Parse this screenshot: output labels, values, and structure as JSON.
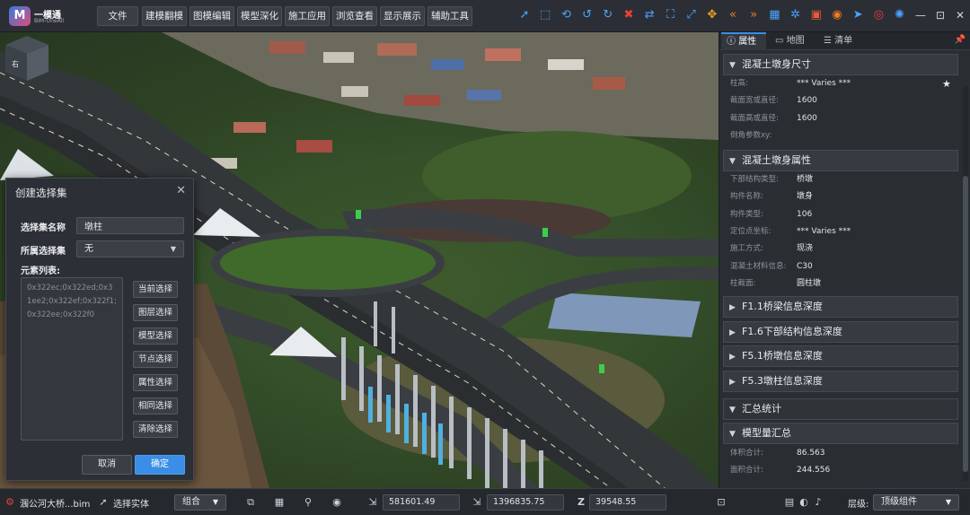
{
  "app": {
    "logo_text": "一模通",
    "logo_sub": "BIM-OneAll"
  },
  "menu": [
    {
      "label": "文件"
    },
    {
      "label": "建模翻模"
    },
    {
      "label": "图模编辑"
    },
    {
      "label": "模型深化"
    },
    {
      "label": "施工应用"
    },
    {
      "label": "浏览查看"
    },
    {
      "label": "显示展示"
    },
    {
      "label": "辅助工具"
    }
  ],
  "toolbar_icons": [
    {
      "name": "select-cursor-icon",
      "glyph": "➚",
      "color": "#4aa3ff"
    },
    {
      "name": "box-select-icon",
      "glyph": "⬚",
      "color": "#4aa3ff"
    },
    {
      "name": "sync-icon",
      "glyph": "⟲",
      "color": "#4aa3ff"
    },
    {
      "name": "undo-icon",
      "glyph": "↺",
      "color": "#4aa3ff"
    },
    {
      "name": "redo-icon",
      "glyph": "↻",
      "color": "#4aa3ff"
    },
    {
      "name": "delete-icon",
      "glyph": "✖",
      "color": "#e8423a"
    },
    {
      "name": "transform-icon",
      "glyph": "⇄",
      "color": "#4aa3ff"
    },
    {
      "name": "zoom-fit-icon",
      "glyph": "⛶",
      "color": "#4aa3ff"
    },
    {
      "name": "zoom-extents-icon",
      "glyph": "⤢",
      "color": "#4aa3ff"
    },
    {
      "name": "move-icon",
      "glyph": "✥",
      "color": "#f0a020"
    },
    {
      "name": "prev-view-icon",
      "glyph": "«",
      "color": "#f07a20"
    },
    {
      "name": "next-view-icon",
      "glyph": "»",
      "color": "#f07a20"
    },
    {
      "name": "grid-view-icon",
      "glyph": "▦",
      "color": "#4aa3ff"
    },
    {
      "name": "explode-icon",
      "glyph": "✲",
      "color": "#4aa3ff"
    },
    {
      "name": "section-box-icon",
      "glyph": "▣",
      "color": "#e85a3a"
    },
    {
      "name": "camera-icon",
      "glyph": "◉",
      "color": "#f07a20"
    },
    {
      "name": "pointer-icon",
      "glyph": "➤",
      "color": "#4aa3ff"
    },
    {
      "name": "target-icon",
      "glyph": "◎",
      "color": "#e8423a"
    },
    {
      "name": "settings-icon",
      "glyph": "✺",
      "color": "#4aa3ff"
    }
  ],
  "window_controls": [
    {
      "name": "minimize-icon",
      "glyph": "—"
    },
    {
      "name": "maximize-icon",
      "glyph": "⊡"
    },
    {
      "name": "close-icon",
      "glyph": "✕"
    }
  ],
  "navcube": {
    "face_label": "右"
  },
  "dialog": {
    "title": "创建选择集",
    "name_label": "选择集名称",
    "name_value": "墩柱",
    "group_label": "所属选择集",
    "group_value": "无",
    "list_label": "元素列表:",
    "list_text": "0x322ec;0x322ed;0x31ee2;0x322ef;0x322f1;0x322ee;0x322f0",
    "buttons": [
      {
        "label": "当前选择",
        "name": "current-selection-button"
      },
      {
        "label": "图层选择",
        "name": "layer-selection-button"
      },
      {
        "label": "模型选择",
        "name": "model-selection-button"
      },
      {
        "label": "节点选择",
        "name": "node-selection-button"
      },
      {
        "label": "属性选择",
        "name": "property-selection-button"
      },
      {
        "label": "相同选择",
        "name": "same-selection-button"
      },
      {
        "label": "清除选择",
        "name": "clear-selection-button"
      }
    ],
    "cancel_label": "取消",
    "ok_label": "确定"
  },
  "panel": {
    "tabs": [
      {
        "label": "属性",
        "glyph": "ⓘ"
      },
      {
        "label": "地图",
        "glyph": "▭"
      },
      {
        "label": "清单",
        "glyph": "☰"
      }
    ],
    "section1": {
      "title": "混凝土墩身尺寸",
      "rows": [
        {
          "k": "柱高:",
          "v": "*** Varies ***"
        },
        {
          "k": "截面宽或直径:",
          "v": "1600"
        },
        {
          "k": "截面高或直径:",
          "v": "1600"
        },
        {
          "k": "倒角参数xy:",
          "v": ""
        }
      ]
    },
    "section2": {
      "title": "混凝土墩身属性",
      "rows": [
        {
          "k": "下部结构类型:",
          "v": "桥墩"
        },
        {
          "k": "构件名称:",
          "v": "墩身"
        },
        {
          "k": "构件类型:",
          "v": "106"
        },
        {
          "k": "定位点坐标:",
          "v": "*** Varies ***"
        },
        {
          "k": "施工方式:",
          "v": "现浇"
        },
        {
          "k": "混凝土材料信息:",
          "v": "C30"
        },
        {
          "k": "柱截面:",
          "v": "圆柱墩"
        }
      ]
    },
    "collapsed": [
      {
        "title": "F1.1桥梁信息深度"
      },
      {
        "title": "F1.6下部结构信息深度"
      },
      {
        "title": "F5.1桥墩信息深度"
      },
      {
        "title": "F5.3墩柱信息深度"
      }
    ],
    "summary_title": "汇总统计",
    "section3": {
      "title": "模型量汇总",
      "rows": [
        {
          "k": "体积合计:",
          "v": "86.563"
        },
        {
          "k": "面积合计:",
          "v": "244.556"
        }
      ]
    }
  },
  "status": {
    "file_name": "涠公河大桥...bim",
    "select_mode": "选择实体",
    "combo": "组合",
    "x": "581601.49",
    "y": "1396835.75",
    "z": "39548.55",
    "layer_label": "层级:",
    "layer_value": "顶级组件"
  }
}
